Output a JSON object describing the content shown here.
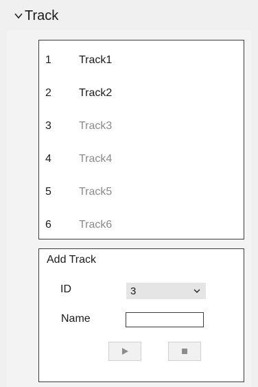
{
  "section": {
    "title": "Track",
    "icon": "chevron-down-icon"
  },
  "tracks": [
    {
      "index": "1",
      "name": "Track1",
      "enabled": true
    },
    {
      "index": "2",
      "name": "Track2",
      "enabled": true
    },
    {
      "index": "3",
      "name": "Track3",
      "enabled": false
    },
    {
      "index": "4",
      "name": "Track4",
      "enabled": false
    },
    {
      "index": "5",
      "name": "Track5",
      "enabled": false
    },
    {
      "index": "6",
      "name": "Track6",
      "enabled": false
    }
  ],
  "add_track": {
    "legend": "Add Track",
    "id_label": "ID",
    "id_value": "3",
    "name_label": "Name",
    "name_value": "",
    "play_icon": "play-icon",
    "stop_icon": "stop-icon"
  },
  "colors": {
    "enabled_text": "#1a1a1a",
    "disabled_text": "#8a8a8a",
    "panel_bg": "#f3f3f3",
    "border": "#3c3c3c"
  }
}
